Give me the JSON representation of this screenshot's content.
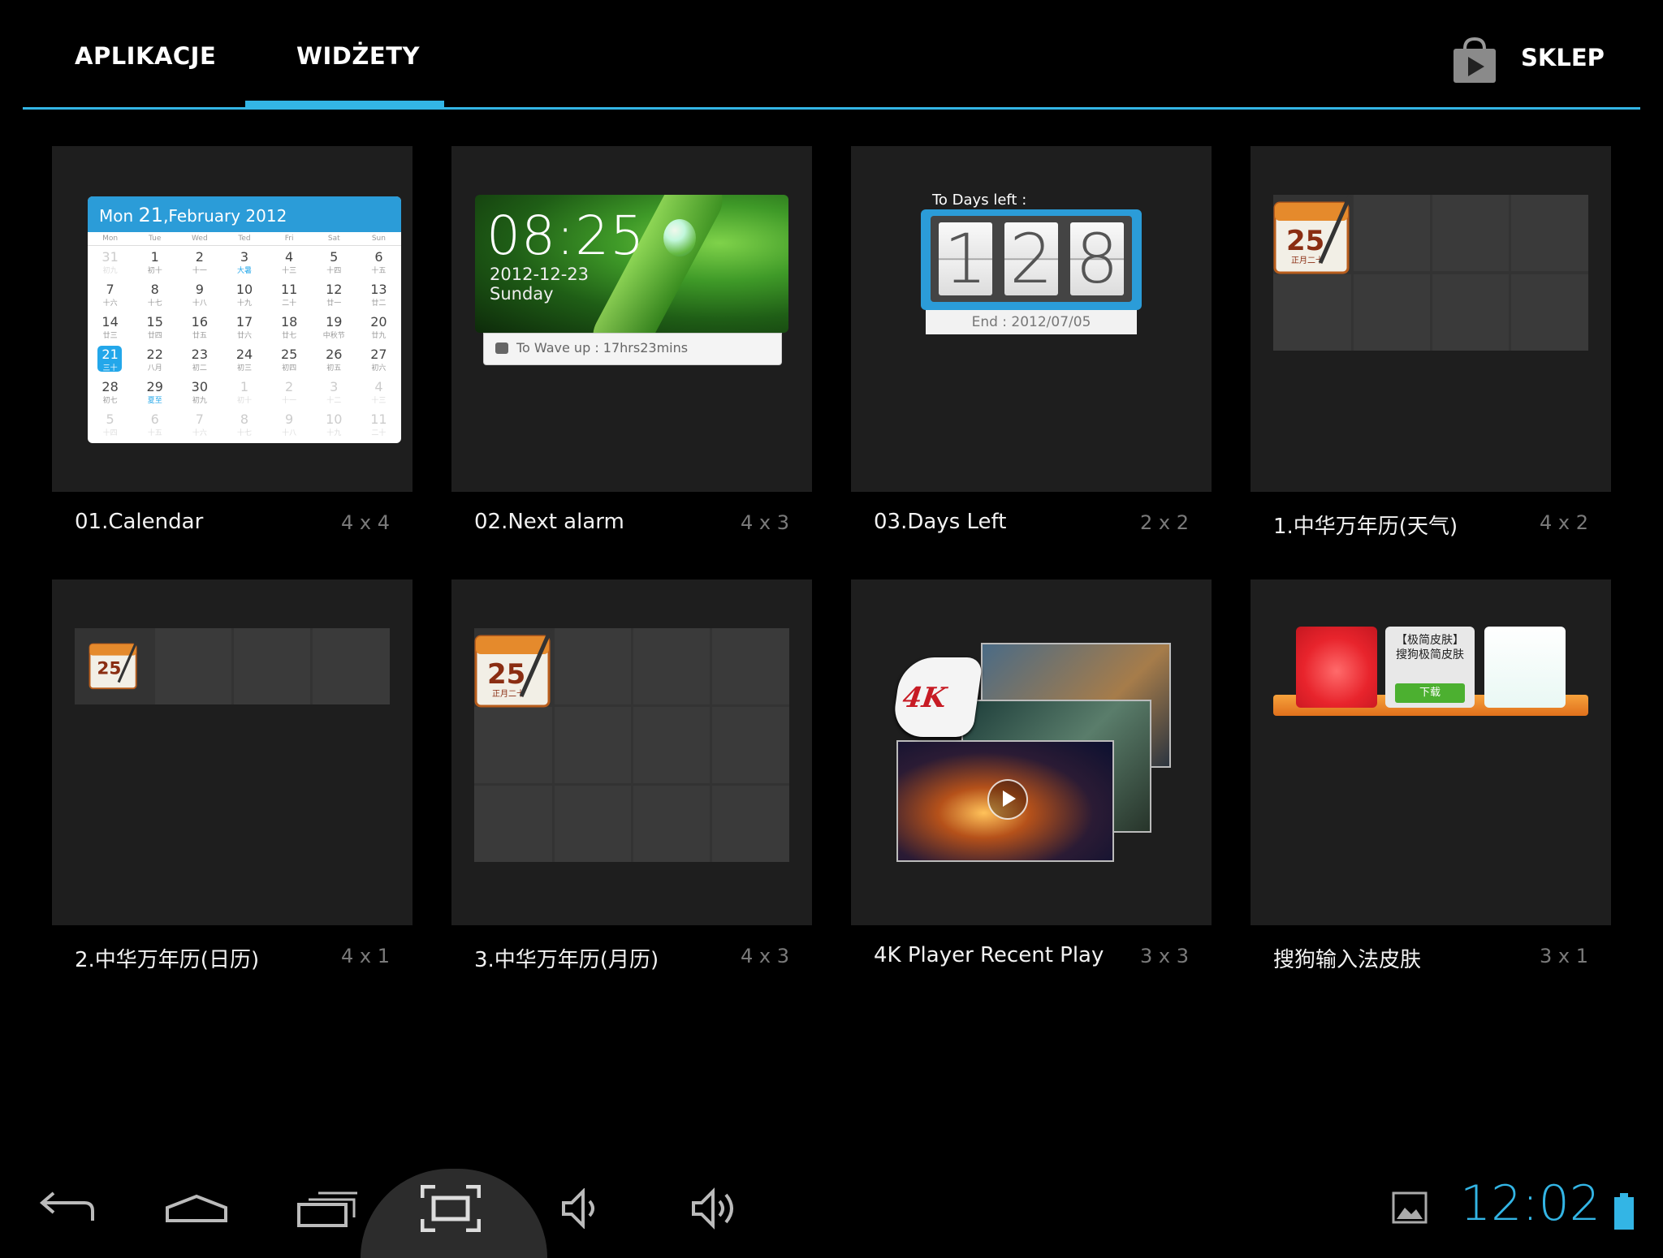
{
  "tabs": {
    "apps_label": "APLIKACJE",
    "widgets_label": "WIDŻETY",
    "active": "WIDŻETY",
    "store_label": "SKLEP",
    "accent_color": "#33b5e5"
  },
  "widgets": [
    {
      "name": "01.Calendar",
      "size": "4 x 4"
    },
    {
      "name": "02.Next alarm",
      "size": "4 x 3"
    },
    {
      "name": "03.Days Left",
      "size": "2 x 2"
    },
    {
      "name": "1.中华万年历(天气)",
      "size": "4 x 2"
    },
    {
      "name": "2.中华万年历(日历)",
      "size": "4 x 1"
    },
    {
      "name": "3.中华万年历(月历)",
      "size": "4 x 3"
    },
    {
      "name": "4K Player Recent Play",
      "size": "3 x 3"
    },
    {
      "name": "搜狗输入法皮肤",
      "size": "3 x 1"
    }
  ],
  "calendar_preview": {
    "header_prefix": "Mon ",
    "header_day": "21",
    "header_suffix": ",February 2012",
    "weekdays": [
      "Mon",
      "Tue",
      "Wed",
      "Ted",
      "Fri",
      "Sat",
      "Sun"
    ],
    "rows": [
      [
        [
          "31",
          "初九"
        ],
        [
          "1",
          "初十"
        ],
        [
          "2",
          "十一"
        ],
        [
          "3",
          "大暑"
        ],
        [
          "4",
          "十三"
        ],
        [
          "5",
          "十四"
        ],
        [
          "6",
          "十五"
        ]
      ],
      [
        [
          "7",
          "十六"
        ],
        [
          "8",
          "十七"
        ],
        [
          "9",
          "十八"
        ],
        [
          "10",
          "十九"
        ],
        [
          "11",
          "二十"
        ],
        [
          "12",
          "廿一"
        ],
        [
          "13",
          "廿二"
        ]
      ],
      [
        [
          "14",
          "廿三"
        ],
        [
          "15",
          "廿四"
        ],
        [
          "16",
          "廿五"
        ],
        [
          "17",
          "廿六"
        ],
        [
          "18",
          "廿七"
        ],
        [
          "19",
          "中秋节"
        ],
        [
          "20",
          "廿九"
        ]
      ],
      [
        [
          "21",
          "三十"
        ],
        [
          "22",
          "八月"
        ],
        [
          "23",
          "初二"
        ],
        [
          "24",
          "初三"
        ],
        [
          "25",
          "初四"
        ],
        [
          "26",
          "初五"
        ],
        [
          "27",
          "初六"
        ]
      ],
      [
        [
          "28",
          "初七"
        ],
        [
          "29",
          "夏至"
        ],
        [
          "30",
          "初九"
        ],
        [
          "1",
          "初十"
        ],
        [
          "2",
          "十一"
        ],
        [
          "3",
          "十二"
        ],
        [
          "4",
          "十三"
        ]
      ],
      [
        [
          "5",
          "十四"
        ],
        [
          "6",
          "十五"
        ],
        [
          "7",
          "十六"
        ],
        [
          "8",
          "十七"
        ],
        [
          "9",
          "十八"
        ],
        [
          "10",
          "十九"
        ],
        [
          "11",
          "二十"
        ]
      ]
    ]
  },
  "alarm_preview": {
    "time": "08:25",
    "date": "2012-12-23",
    "weekday": "Sunday",
    "wake_text": "To Wave up : 17hrs23mins"
  },
  "days_left_preview": {
    "title": "To Days left :",
    "digits": [
      "1",
      "2",
      "8"
    ],
    "end_text": "End : 2012/07/05"
  },
  "cn_calendar_icon": {
    "day": "25",
    "sub": "正月二十"
  },
  "k4_preview": {
    "badge": "4K"
  },
  "sogou_preview": {
    "title_line1": "【极简皮肤】",
    "title_line2": "搜狗极简皮肤",
    "download": "下载"
  },
  "status": {
    "clock": "12:02"
  },
  "icons": {
    "store": "shopping-bag-play-icon",
    "back": "back-icon",
    "home": "home-icon",
    "recents": "recents-icon",
    "screenshot": "screenshot-icon",
    "vol_down": "volume-down-icon",
    "vol_up": "volume-up-icon",
    "gallery": "gallery-icon",
    "battery": "battery-icon"
  }
}
